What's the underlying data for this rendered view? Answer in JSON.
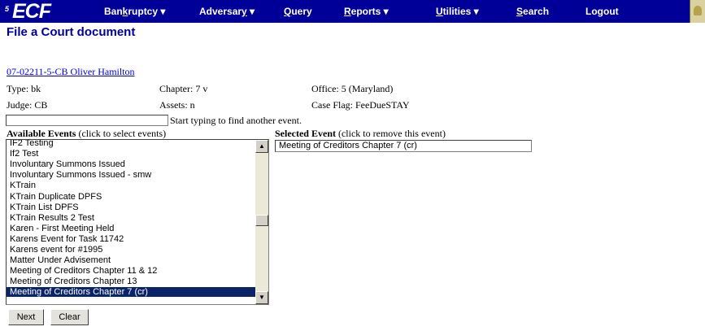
{
  "logo": {
    "small": "5",
    "text": "ECF"
  },
  "menu": {
    "bankruptcy": {
      "prefix": "Ban",
      "accel": "k",
      "rest": "ruptcy ▾"
    },
    "adversary": {
      "prefix": "Adversar",
      "accel": "y",
      "rest": " ▾"
    },
    "query": {
      "prefix": "",
      "accel": "Q",
      "rest": "uery"
    },
    "reports": {
      "prefix": "",
      "accel": "R",
      "rest": "eports ▾"
    },
    "utilities": {
      "prefix": "",
      "accel": "U",
      "rest": "tilities ▾"
    },
    "search": {
      "prefix": "",
      "accel": "S",
      "rest": "earch"
    },
    "logout": {
      "prefix": "",
      "accel": "",
      "rest": "Logout"
    }
  },
  "page": {
    "title": "File a Court document"
  },
  "case": {
    "link": "07-02211-5-CB Oliver Hamilton",
    "type": "Type: bk",
    "chapter": "Chapter: 7 v",
    "office": "Office: 5 (Maryland)",
    "judge": "Judge: CB",
    "assets": "Assets: n",
    "flag": "Case Flag: FeeDueSTAY"
  },
  "search": {
    "value": "",
    "hint": "Start typing to find another event."
  },
  "available": {
    "heading": "Available Events",
    "note": "(click to select events)"
  },
  "selected": {
    "heading": "Selected Event",
    "note": "(click to remove this event)",
    "value": "Meeting of Creditors Chapter 7 (cr)"
  },
  "events": [
    "IF2 Testing",
    "If2 Test",
    "Involuntary Summons Issued",
    "Involuntary Summons Issued - smw",
    "KTrain",
    "KTrain Duplicate DPFS",
    "KTrain List DPFS",
    "KTrain Results 2 Test",
    "Karen - First Meeting Held",
    "Karens Event for Task 11742",
    "Karens event for #1995",
    "Matter Under Advisement",
    "Meeting of Creditors Chapter 11 & 12",
    "Meeting of Creditors Chapter 13",
    "Meeting of Creditors Chapter 7 (cr)"
  ],
  "buttons": {
    "next": "Next",
    "clear": "Clear"
  },
  "colors": {
    "menubar": "#000099",
    "title": "#000099",
    "link": "#0000cc",
    "selection": "#0a246a"
  }
}
